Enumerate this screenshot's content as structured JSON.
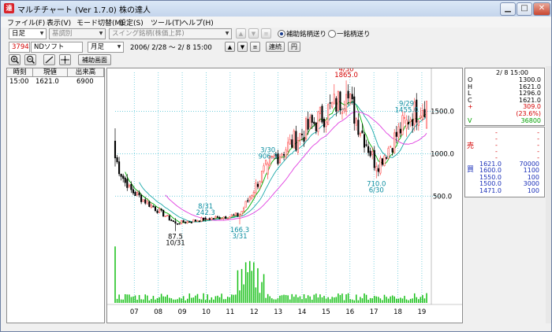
{
  "window": {
    "app_title": "マルチチャート (Ver 1.7.0)  株の達人",
    "app_icon_text": "達",
    "minimize": "▁",
    "maximize": "□",
    "close": "✕"
  },
  "menu": [
    "ファイル(F)",
    "表示(V)",
    "モード切替(M)",
    "設定(S)",
    "ツール(T)",
    "ヘルプ(H)"
  ],
  "toolbar1": {
    "period_select": "日足",
    "indicator_select": "基調別",
    "screen_select": "スイング銘柄(株価上昇)",
    "up_btn": "▲",
    "down_btn": "▼",
    "menu_btn": "≡",
    "radio1_label": "補助銘柄送り",
    "radio2_label": "一銘柄送り",
    "radio_selected": "radio1"
  },
  "toolbar2": {
    "code": "3794",
    "name": "NDソフト",
    "period": "月足",
    "date_range": "2006/ 2/28 ～  2/ 8 15:00",
    "up_btn": "▲",
    "down_btn": "▼",
    "menu_btn": "≡",
    "renzoku_btn": "連続",
    "yen_btn": "円"
  },
  "toolbar3": {
    "zoom_in_icon": "zoom-in-icon",
    "zoom_out_icon": "zoom-out-icon",
    "line_icon": "line-tool-icon",
    "cross_icon": "crosshair-icon",
    "sub_screen_btn": "補助画面"
  },
  "tick_table": {
    "headers": [
      "時刻",
      "現値",
      "出来高"
    ],
    "rows": [
      {
        "time": "15:00",
        "price": "1621.0",
        "volume": "6900"
      }
    ]
  },
  "ohlc_panel": {
    "date": "2/ 8 15:00",
    "rows": [
      {
        "k": "O",
        "v": "1300.0",
        "color": "#000000"
      },
      {
        "k": "H",
        "v": "1621.0",
        "color": "#000000"
      },
      {
        "k": "L",
        "v": "1296.0",
        "color": "#000000"
      },
      {
        "k": "C",
        "v": "1621.0",
        "color": "#000000"
      },
      {
        "k": "+",
        "v": "309.0",
        "color": "#d40000"
      },
      {
        "k": "",
        "v": "(23.6%)",
        "color": "#d40000"
      },
      {
        "k": "V",
        "v": "36800",
        "color": "#00a000"
      }
    ]
  },
  "board": {
    "sell_label": "売",
    "buy_label": "買",
    "sell_rows": [
      "-",
      "-",
      "-",
      "-",
      "-"
    ],
    "buy_rows": [
      {
        "price": "1621.0",
        "qty": "70000"
      },
      {
        "price": "1600.0",
        "qty": "1100"
      },
      {
        "price": "1550.0",
        "qty": "100"
      },
      {
        "price": "1500.0",
        "qty": "3000"
      },
      {
        "price": "1471.0",
        "qty": "100"
      }
    ]
  },
  "chart_data": {
    "type": "candlestick",
    "symbol": "3794 NDソフト",
    "period": "monthly",
    "x_tick_labels": [
      "07",
      "08",
      "09",
      "10",
      "11",
      "12",
      "13",
      "14",
      "15",
      "16",
      "17",
      "18",
      "19"
    ],
    "y_tick_labels": [
      "1500.0",
      "1000.0",
      "500.0"
    ],
    "y_ticks": [
      1500,
      1000,
      500
    ],
    "ylim": [
      150,
      1960
    ],
    "grid": true,
    "grid_style": "dotted-cyan",
    "colors": {
      "up": "#ff4a4a",
      "down": "#000000",
      "ma_short": "#00b000",
      "ma_mid": "#18a8a8",
      "ma_long": "#e040e0",
      "volume": "#18c018",
      "annotation_red": "#d40000",
      "annotation_cyan": "#0b8ea0",
      "annotation_black": "#000000"
    },
    "candles": {
      "count": 156,
      "x_range": [
        0,
        155
      ],
      "key_points": [
        {
          "i": 0,
          "o": 1150,
          "h": 1300,
          "l": 850,
          "c": 950
        },
        {
          "i": 6,
          "o": 700,
          "h": 760,
          "l": 560,
          "c": 600
        },
        {
          "i": 30,
          "o": 200,
          "h": 240,
          "l": 87.5,
          "c": 180
        },
        {
          "i": 45,
          "o": 242,
          "h": 260,
          "l": 200,
          "c": 230
        },
        {
          "i": 62,
          "o": 260,
          "h": 300,
          "l": 166.3,
          "c": 280
        },
        {
          "i": 76,
          "o": 760,
          "h": 906.3,
          "l": 700,
          "c": 880
        },
        {
          "i": 115,
          "o": 1500,
          "h": 1865,
          "l": 1450,
          "c": 1700
        },
        {
          "i": 130,
          "o": 800,
          "h": 900,
          "l": 710,
          "c": 850
        },
        {
          "i": 145,
          "o": 1300,
          "h": 1455,
          "l": 1200,
          "c": 1400
        },
        {
          "i": 155,
          "o": 1300,
          "h": 1621,
          "l": 1296,
          "c": 1621
        }
      ]
    },
    "annotations": [
      {
        "i": 115,
        "value": 1865.0,
        "label_top": "4/30",
        "label_bottom": "1865.0",
        "color": "red",
        "pos": "above"
      },
      {
        "i": 76,
        "value": 906.3,
        "label_top": "3/30",
        "label_bottom": "906.3",
        "color": "cyan",
        "pos": "above"
      },
      {
        "i": 45,
        "value": 242.3,
        "label_top": "8/31",
        "label_bottom": "242.3",
        "color": "cyan",
        "pos": "above"
      },
      {
        "i": 145,
        "value": 1455.0,
        "label_top": "9/29",
        "label_bottom": "1455.0",
        "color": "cyan",
        "pos": "above"
      },
      {
        "i": 62,
        "value": 166.3,
        "label_top": "166.3",
        "label_bottom": "3/31",
        "color": "cyan",
        "pos": "below"
      },
      {
        "i": 30,
        "value": 87.5,
        "label_top": "87.5",
        "label_bottom": "10/31",
        "color": "black",
        "pos": "below"
      },
      {
        "i": 130,
        "value": 710.0,
        "label_top": "710.0",
        "label_bottom": "6/30",
        "color": "cyan",
        "pos": "below"
      }
    ]
  }
}
